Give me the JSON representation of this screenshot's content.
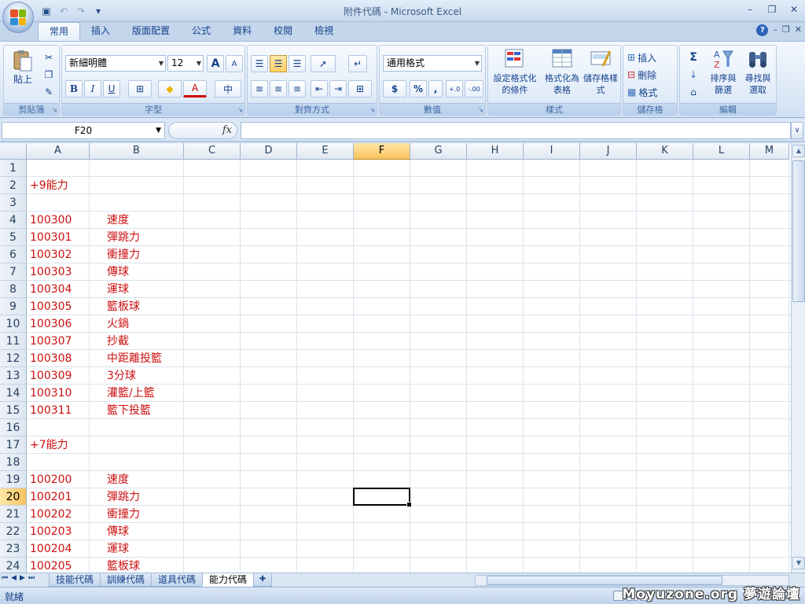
{
  "window": {
    "title": "附件代碼 - Microsoft Excel",
    "min": "–",
    "restore": "❐",
    "close": "✕",
    "doc_min": "–",
    "doc_restore": "❐",
    "doc_close": "✕",
    "help": "?"
  },
  "qat": {
    "save_icon": "▣",
    "undo_icon": "↶",
    "redo_icon": "↷",
    "customize_icon": "▾"
  },
  "tabs": [
    "常用",
    "插入",
    "版面配置",
    "公式",
    "資料",
    "校閱",
    "檢視"
  ],
  "ribbon": {
    "clipboard": {
      "label": "剪貼簿",
      "paste": "貼上",
      "cut_icon": "✂",
      "copy_icon": "❐",
      "format_painter_icon": "✎"
    },
    "font": {
      "label": "字型",
      "font_name": "新細明體",
      "font_size": "12",
      "grow": "A",
      "shrink": "A",
      "bold": "B",
      "italic": "I",
      "underline": "U",
      "border_icon": "⊞",
      "fill_icon": "◆",
      "font_color": "A",
      "phonetic": "中"
    },
    "alignment": {
      "label": "對齊方式"
    },
    "number": {
      "label": "數值",
      "format": "通用格式",
      "currency": "$",
      "percent": "%",
      "comma": ",",
      "inc_decimal": "+.0",
      "dec_decimal": "-.00"
    },
    "styles": {
      "label": "樣式",
      "conditional": "設定格式化的條件",
      "format_table": "格式化為表格",
      "cell_styles": "儲存格樣式"
    },
    "cells": {
      "label": "儲存格",
      "insert": "插入",
      "delete": "刪除",
      "format": "格式"
    },
    "editing": {
      "label": "編輯",
      "sum_icon": "Σ",
      "fill_icon": "↓",
      "clear_icon": "⌂",
      "sort": "排序與篩選",
      "find": "尋找與選取"
    }
  },
  "formula_bar": {
    "name_box": "F20",
    "fx": "fx",
    "value": ""
  },
  "columns": [
    "A",
    "B",
    "C",
    "D",
    "E",
    "F",
    "G",
    "H",
    "I",
    "J",
    "K",
    "L",
    "M"
  ],
  "selected_column": "F",
  "selected_row": "20",
  "rows": [
    {
      "n": "1",
      "a": "",
      "b": ""
    },
    {
      "n": "2",
      "a": "+9能力",
      "b": ""
    },
    {
      "n": "3",
      "a": "",
      "b": ""
    },
    {
      "n": "4",
      "a": "100300",
      "b": "速度"
    },
    {
      "n": "5",
      "a": "100301",
      "b": "彈跳力"
    },
    {
      "n": "6",
      "a": "100302",
      "b": "衝撞力"
    },
    {
      "n": "7",
      "a": "100303",
      "b": "傳球"
    },
    {
      "n": "8",
      "a": "100304",
      "b": "運球"
    },
    {
      "n": "9",
      "a": "100305",
      "b": "籃板球"
    },
    {
      "n": "10",
      "a": "100306",
      "b": "火鍋"
    },
    {
      "n": "11",
      "a": "100307",
      "b": "抄截"
    },
    {
      "n": "12",
      "a": "100308",
      "b": "中距離投籃"
    },
    {
      "n": "13",
      "a": "100309",
      "b": "3分球"
    },
    {
      "n": "14",
      "a": "100310",
      "b": "灌籃/上籃"
    },
    {
      "n": "15",
      "a": "100311",
      "b": "籃下投籃"
    },
    {
      "n": "16",
      "a": "",
      "b": ""
    },
    {
      "n": "17",
      "a": "+7能力",
      "b": ""
    },
    {
      "n": "18",
      "a": "",
      "b": ""
    },
    {
      "n": "19",
      "a": "100200",
      "b": "速度"
    },
    {
      "n": "20",
      "a": "100201",
      "b": "彈跳力"
    },
    {
      "n": "21",
      "a": "100202",
      "b": "衝撞力"
    },
    {
      "n": "22",
      "a": "100203",
      "b": "傳球"
    },
    {
      "n": "23",
      "a": "100204",
      "b": "運球"
    },
    {
      "n": "24",
      "a": "100205",
      "b": "籃板球"
    }
  ],
  "sheets": [
    "技能代碼",
    "訓練代碼",
    "道具代碼",
    "能力代碼"
  ],
  "active_sheet": "能力代碼",
  "sheet_nav": [
    "⏮",
    "◀",
    "▶",
    "⏭"
  ],
  "status": {
    "ready": "就緒",
    "watermark": "Moyuzone.org 夢遊論壇"
  },
  "colors": {
    "cell_text": "#cc1010",
    "accent": "#15428b",
    "selection": "#f8c35b"
  }
}
